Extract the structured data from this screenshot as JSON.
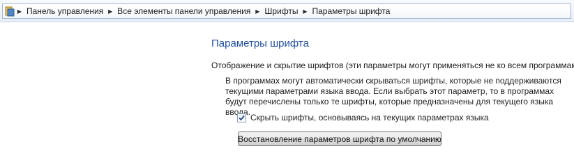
{
  "address_bar": {
    "icon": "control-panel-icon",
    "breadcrumbs": [
      "Панель управления",
      "Все элементы панели управления",
      "Шрифты",
      "Параметры шрифта"
    ]
  },
  "main": {
    "title": "Параметры шрифта",
    "group_header": "Отображение и скрытие шрифтов (эти параметры могут применяться не ко всем программам)",
    "description": "В программах могут автоматически скрываться шрифты, которые не поддерживаются текущими параметрами языка ввода. Если выбрать этот параметр, то в программах будут перечислены только те шрифты, которые предназначены для текущего языка ввода.",
    "hide_fonts_checkbox": {
      "label": "Скрыть шрифты, основываясь на текущих параметрах языка",
      "checked": true
    },
    "restore_button_label": "Восстановление параметров шрифта по умолчанию"
  },
  "colors": {
    "title": "#1f4e9c",
    "checkmark": "#2d4d87"
  }
}
